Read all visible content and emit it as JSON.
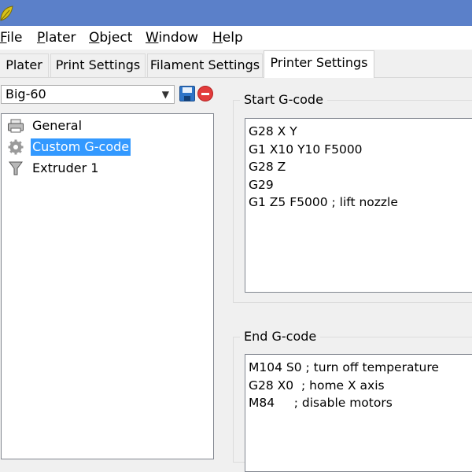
{
  "window": {
    "icon": "app-leaf-icon",
    "title_bar_color": "#5b80c9"
  },
  "menu": {
    "items": [
      {
        "acc": "F",
        "rest": "ile"
      },
      {
        "acc": "P",
        "rest": "later"
      },
      {
        "acc": "O",
        "rest": "bject"
      },
      {
        "acc": "W",
        "rest": "indow"
      },
      {
        "acc": "H",
        "rest": "elp"
      }
    ]
  },
  "tabs": [
    {
      "label": "Plater",
      "active": false
    },
    {
      "label": "Print Settings",
      "active": false
    },
    {
      "label": "Filament Settings",
      "active": false
    },
    {
      "label": "Printer Settings",
      "active": true
    }
  ],
  "preset": {
    "selected": "Big-60",
    "save_icon": "save-icon",
    "delete_icon": "delete-icon"
  },
  "tree": {
    "items": [
      {
        "label": "General",
        "icon": "printer-icon",
        "selected": false
      },
      {
        "label": "Custom G-code",
        "icon": "gear-icon",
        "selected": true
      },
      {
        "label": "Extruder 1",
        "icon": "funnel-icon",
        "selected": false
      }
    ],
    "selection_color": "#3399ff"
  },
  "start_gcode": {
    "title": "Start G-code",
    "lines": [
      "G28 X Y",
      "G1 X10 Y10 F5000",
      "G28 Z",
      "G29",
      "G1 Z5 F5000 ; lift nozzle"
    ]
  },
  "end_gcode": {
    "title": "End G-code",
    "lines": [
      "M104 S0 ; turn off temperature",
      "G28 X0  ; home X axis",
      "M84     ; disable motors"
    ]
  }
}
